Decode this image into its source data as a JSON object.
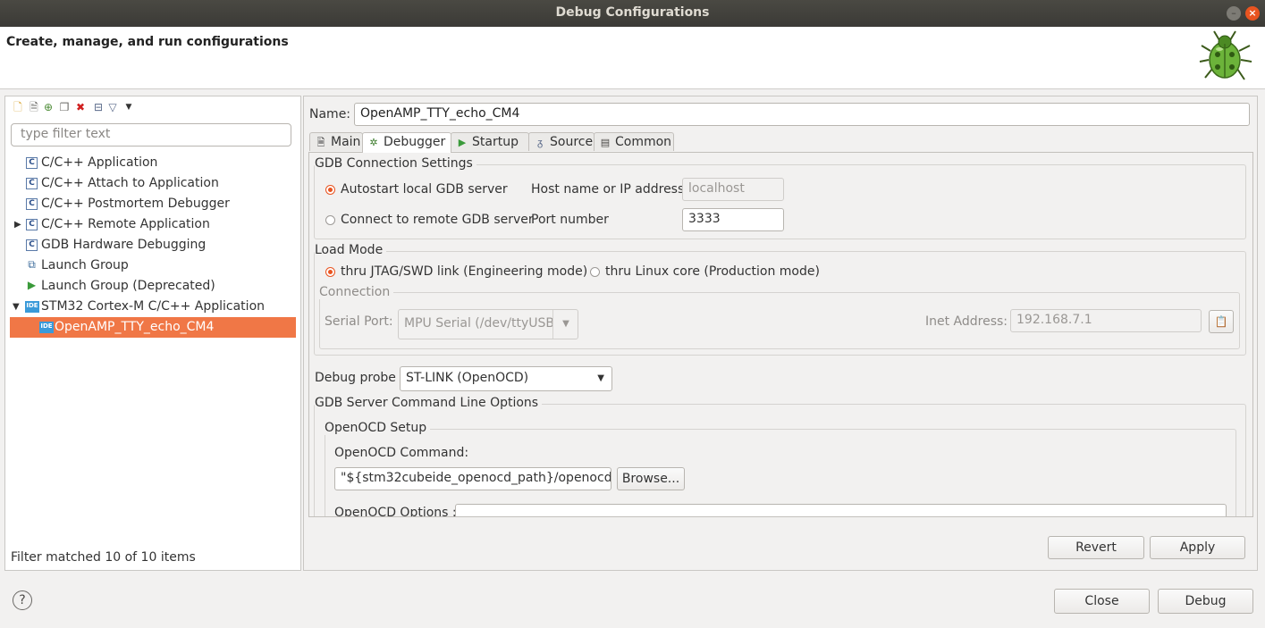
{
  "window": {
    "title": "Debug Configurations",
    "minimize": "–",
    "close": "×"
  },
  "banner": {
    "heading": "Create, manage, and run configurations"
  },
  "left": {
    "filter_placeholder": "type filter text",
    "tree": [
      {
        "label": "C/C++ Application",
        "icon": "c-config-icon"
      },
      {
        "label": "C/C++ Attach to Application",
        "icon": "c-config-icon"
      },
      {
        "label": "C/C++ Postmortem Debugger",
        "icon": "c-config-icon"
      },
      {
        "label": "C/C++ Remote Application",
        "icon": "c-config-icon"
      },
      {
        "label": "GDB Hardware Debugging",
        "icon": "c-config-icon"
      },
      {
        "label": "Launch Group",
        "icon": "launch-group-icon"
      },
      {
        "label": "Launch Group (Deprecated)",
        "icon": "run-icon"
      },
      {
        "label": "STM32 Cortex-M C/C++ Application",
        "icon": "ide-icon"
      },
      {
        "label": "OpenAMP_TTY_echo_CM4",
        "icon": "ide-icon"
      }
    ],
    "ide_badge": "IDE",
    "c_badge": "C",
    "status": "Filter matched 10 of 10 items"
  },
  "right": {
    "name_label": "Name:",
    "name_value": "OpenAMP_TTY_echo_CM4",
    "tabs": [
      {
        "label": "Main",
        "icon": "main-tab-icon"
      },
      {
        "label": "Debugger",
        "icon": "debugger-tab-icon"
      },
      {
        "label": "Startup",
        "icon": "startup-tab-icon"
      },
      {
        "label": "Source",
        "icon": "source-tab-icon"
      },
      {
        "label": "Common",
        "icon": "common-tab-icon"
      }
    ],
    "gdb_connection": {
      "title": "GDB Connection Settings",
      "autostart": "Autostart local GDB server",
      "connect_remote": "Connect to remote GDB server",
      "host_label": "Host name or IP address",
      "host_value": "localhost",
      "port_label": "Port number",
      "port_value": "3333"
    },
    "load_mode": {
      "title": "Load Mode",
      "jtag": "thru JTAG/SWD link (Engineering mode)",
      "linux": "thru Linux core (Production mode)",
      "connection_title": "Connection",
      "serial_label": "Serial Port:",
      "serial_value": "MPU Serial (/dev/ttyUSB",
      "inet_label": "Inet Address:",
      "inet_value": "192.168.7.1"
    },
    "debug_probe": {
      "label": "Debug probe",
      "value": "ST-LINK (OpenOCD)"
    },
    "gdb_server": {
      "title": "GDB Server Command Line Options",
      "openocd_setup": "OpenOCD Setup",
      "command_label": "OpenOCD Command:",
      "command_value": "\"${stm32cubeide_openocd_path}/openocd\"",
      "browse": "Browse...",
      "options_label": "OpenOCD Options :",
      "options_value": ""
    },
    "revert": "Revert",
    "apply": "Apply"
  },
  "footer": {
    "help": "?",
    "close": "Close",
    "debug": "Debug"
  },
  "colors": {
    "accent": "#e95420",
    "selection": "#f07746"
  }
}
